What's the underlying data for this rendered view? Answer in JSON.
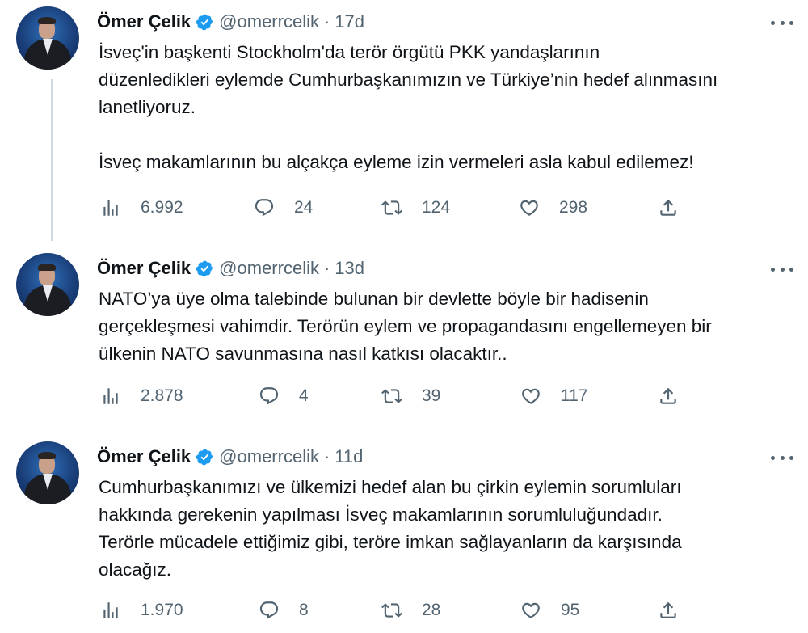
{
  "colors": {
    "text": "#0f1419",
    "secondary": "#536471",
    "verified": "#1d9bf0"
  },
  "tweets": [
    {
      "author_name": "Ömer Çelik",
      "handle": "@omerrcelik",
      "separator": "·",
      "time": "17d",
      "lines": [
        "İsveç'in başkenti Stockholm'da terör örgütü PKK yandaşlarının",
        "düzenledikleri eylemde Cumhurbaşkanımızın ve Türkiye’nin hedef alınmasını",
        "lanetliyoruz.",
        "",
        "İsveç makamlarının bu alçakça eyleme izin vermeleri asla kabul edilemez!"
      ],
      "views": "6.992",
      "replies": "24",
      "retweets": "124",
      "likes": "298"
    },
    {
      "author_name": "Ömer Çelik",
      "handle": "@omerrcelik",
      "separator": "·",
      "time": "13d",
      "lines": [
        "NATO’ya üye olma talebinde bulunan bir devlette böyle bir hadisenin",
        "gerçekleşmesi vahimdir. Terörün eylem ve propagandasını engellemeyen bir",
        "ülkenin NATO savunmasına nasıl katkısı olacaktır.."
      ],
      "views": "2.878",
      "replies": "4",
      "retweets": "39",
      "likes": "117"
    },
    {
      "author_name": "Ömer Çelik",
      "handle": "@omerrcelik",
      "separator": "·",
      "time": "11d",
      "lines": [
        "Cumhurbaşkanımızı ve ülkemizi hedef alan bu çirkin eylemin sorumluları",
        "hakkında gerekenin yapılması İsveç makamlarının sorumluluğundadır.",
        "Terörle mücadele ettiğimiz gibi, teröre imkan sağlayanların da karşısında",
        "olacağız."
      ],
      "views": "1.970",
      "replies": "8",
      "retweets": "28",
      "likes": "95"
    }
  ]
}
